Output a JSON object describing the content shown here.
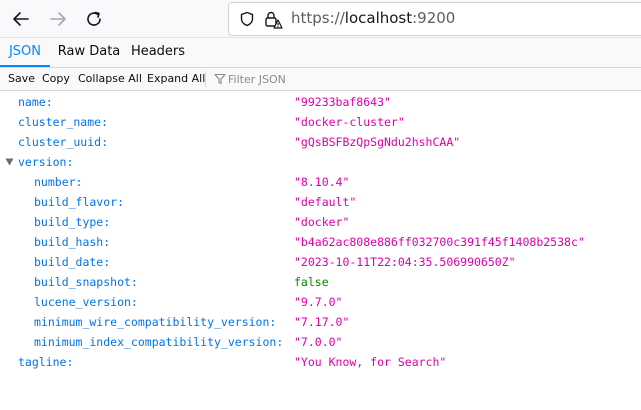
{
  "browser": {
    "url_scheme": "https://",
    "url_host": "localhost",
    "url_port": ":9200"
  },
  "tabs": [
    {
      "label": "JSON"
    },
    {
      "label": "Raw Data"
    },
    {
      "label": "Headers"
    }
  ],
  "toolbar": {
    "save_label": "Save",
    "copy_label": "Copy",
    "collapse_label": "Collapse All",
    "expand_label": "Expand All",
    "filter_placeholder": "Filter JSON"
  },
  "json_tree": {
    "rows": [
      {
        "key": "name:",
        "value": "\"99233baf8643\"",
        "type": "string"
      },
      {
        "key": "cluster_name:",
        "value": "\"docker-cluster\"",
        "type": "string"
      },
      {
        "key": "cluster_uuid:",
        "value": "\"gQsBSFBzQpSgNdu2hshCAA\"",
        "type": "string"
      },
      {
        "key": "version:",
        "value": "",
        "type": "object",
        "expanded": true
      },
      {
        "key": "number:",
        "value": "\"8.10.4\"",
        "type": "string"
      },
      {
        "key": "build_flavor:",
        "value": "\"default\"",
        "type": "string"
      },
      {
        "key": "build_type:",
        "value": "\"docker\"",
        "type": "string"
      },
      {
        "key": "build_hash:",
        "value": "\"b4a62ac808e886ff032700c391f45f1408b2538c\"",
        "type": "string"
      },
      {
        "key": "build_date:",
        "value": "\"2023-10-11T22:04:35.506990650Z\"",
        "type": "string"
      },
      {
        "key": "build_snapshot:",
        "value": "false",
        "type": "boolean"
      },
      {
        "key": "lucene_version:",
        "value": "\"9.7.0\"",
        "type": "string"
      },
      {
        "key": "minimum_wire_compatibility_version:",
        "value": "\"7.17.0\"",
        "type": "string"
      },
      {
        "key": "minimum_index_compatibility_version:",
        "value": "\"7.0.0\"",
        "type": "string"
      },
      {
        "key": "tagline:",
        "value": "\"You Know, for Search\"",
        "type": "string"
      }
    ]
  },
  "colors": {
    "key": "#0074e8",
    "string": "#dd00a9",
    "boolean": "#058b00",
    "accent": "#0a84ff"
  }
}
